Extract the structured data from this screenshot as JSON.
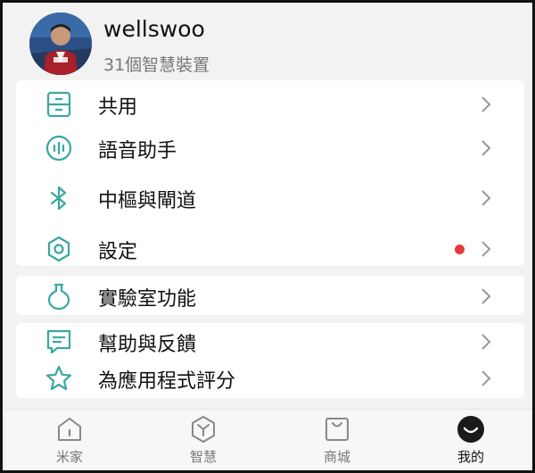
{
  "profile": {
    "username": "wellswoo",
    "device_count": "31個智慧裝置"
  },
  "menu_group_1": [
    {
      "label": "共用",
      "icon": "share-icon"
    },
    {
      "label": "語音助手",
      "icon": "voice-assistant-icon"
    },
    {
      "label": "中樞與閘道",
      "icon": "bluetooth-icon"
    },
    {
      "label": "設定",
      "icon": "settings-icon",
      "badge": true
    }
  ],
  "menu_group_2": [
    {
      "label": "實驗室功能",
      "icon": "flask-icon"
    }
  ],
  "menu_group_3": [
    {
      "label": "幫助與反饋",
      "icon": "feedback-icon"
    },
    {
      "label": "為應用程式評分",
      "icon": "star-icon"
    }
  ],
  "tabs": [
    {
      "label": "米家",
      "icon": "home-icon",
      "active": false
    },
    {
      "label": "智慧",
      "icon": "smart-icon",
      "active": false
    },
    {
      "label": "商城",
      "icon": "shop-icon",
      "active": false
    },
    {
      "label": "我的",
      "icon": "profile-icon",
      "active": true
    }
  ],
  "colors": {
    "accent": "#3aa7a0",
    "badge": "#e53935",
    "chevron": "#999999"
  }
}
